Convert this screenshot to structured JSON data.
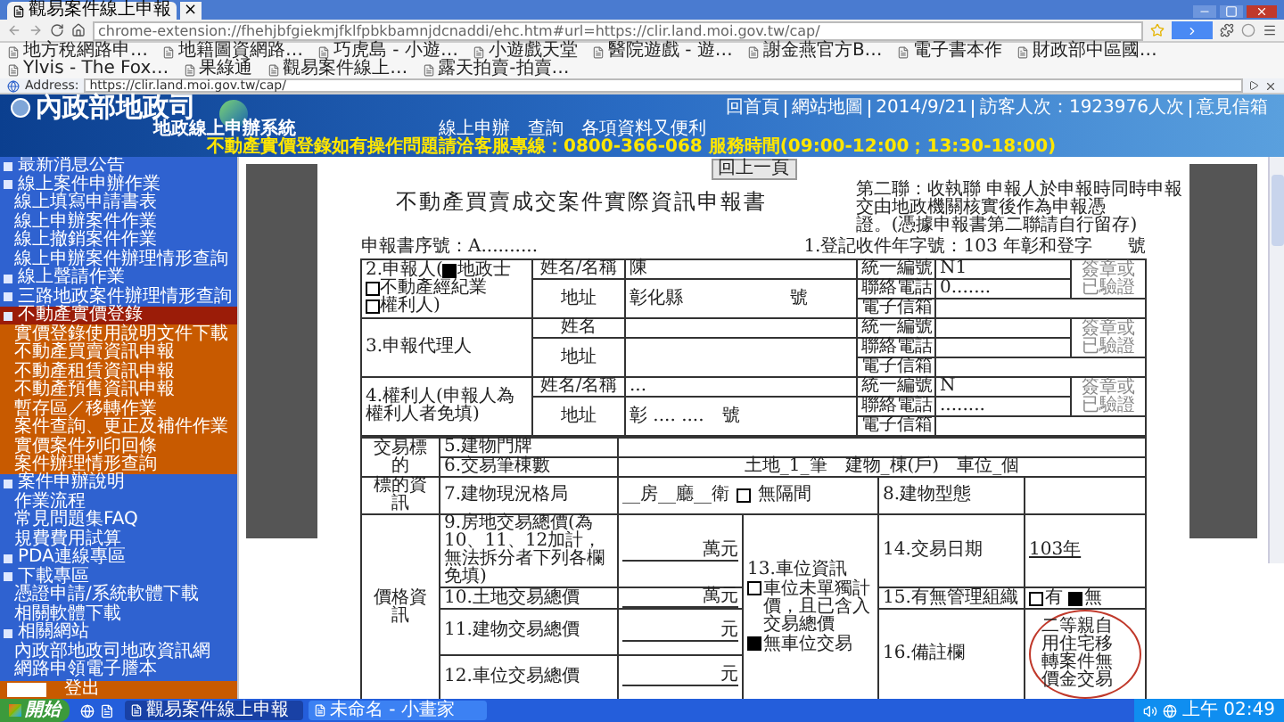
{
  "browser": {
    "tab_title": "觀易案件線上申報",
    "tab_close": "×",
    "url": "chrome-extension://fhehjbfgiekmjfklfpbkbamnjdcnaddi/ehc.htm#url=https://clir.land.moi.gov.tw/cap/",
    "bookmarks": [
      "地方稅網路申…",
      "地籍圖資網路…",
      "巧虎島 - 小遊…",
      "小遊戲天堂",
      "醫院遊戲 - 遊…",
      "謝金燕官方B…",
      "電子書本作",
      "財政部中區國…",
      "Ylvis - The Fox…",
      "果綠通",
      "觀易案件線上…",
      "露天拍賣-拍賣…"
    ],
    "ie_address_label": "Address:",
    "ie_address": "https://clir.land.moi.gov.tw/cap/"
  },
  "banner": {
    "title": "內政部地政司",
    "subtitle": "地政線上申辦系統",
    "links": [
      "回首頁",
      "網站地圖",
      "2014/9/21",
      "訪客人次：1923976人次",
      "意見信箱"
    ],
    "slogans": [
      "線上申辦",
      "查詢",
      "各項資料又便利"
    ],
    "marquee": "不動產實價登錄如有操作問題請洽客服專線：0800-366-068 服務時間(09:00-12:00；13:30-18:00)"
  },
  "sidebar": {
    "items": [
      {
        "label": "最新消息公告",
        "kind": "header",
        "selected": false
      },
      {
        "label": "線上案件申辦作業",
        "kind": "header",
        "selected": false
      },
      {
        "label": "線上填寫申請書表",
        "kind": "link",
        "selected": false
      },
      {
        "label": "線上申辦案件作業",
        "kind": "link",
        "selected": false
      },
      {
        "label": "線上撤銷案件作業",
        "kind": "link",
        "selected": false
      },
      {
        "label": "線上申辦案件辦理情形查詢",
        "kind": "link",
        "selected": false
      },
      {
        "label": "線上聲請作業",
        "kind": "header",
        "selected": false
      },
      {
        "label": "三路地政案件辦理情形查詢",
        "kind": "header",
        "selected": false
      },
      {
        "label": "不動產實價登錄",
        "kind": "header",
        "selected": true
      },
      {
        "label": "實價登錄使用說明文件下載",
        "kind": "sub",
        "selected": false
      },
      {
        "label": "不動產買賣資訊申報",
        "kind": "sub",
        "selected": false
      },
      {
        "label": "不動產租賃資訊申報",
        "kind": "sub",
        "selected": false
      },
      {
        "label": "不動產預售資訊申報",
        "kind": "sub",
        "selected": false
      },
      {
        "label": "暫存區／移轉作業",
        "kind": "sub",
        "selected": false
      },
      {
        "label": "案件查詢、更正及補件作業",
        "kind": "sub",
        "selected": false
      },
      {
        "label": "實價案件列印回條",
        "kind": "sub",
        "selected": false
      },
      {
        "label": "案件辦理情形查詢",
        "kind": "sub",
        "selected": false
      },
      {
        "label": "案件申辦說明",
        "kind": "header",
        "selected": false
      },
      {
        "label": "作業流程",
        "kind": "link",
        "selected": false
      },
      {
        "label": "常見問題集FAQ",
        "kind": "link",
        "selected": false
      },
      {
        "label": "規費費用試算",
        "kind": "link",
        "selected": false
      },
      {
        "label": "PDA連線專區",
        "kind": "header",
        "selected": false
      },
      {
        "label": "下載專區",
        "kind": "header",
        "selected": false
      },
      {
        "label": "憑證申請/系統軟體下載",
        "kind": "link",
        "selected": false
      },
      {
        "label": "相關軟體下載",
        "kind": "link",
        "selected": false
      },
      {
        "label": "相關網站",
        "kind": "header",
        "selected": false
      },
      {
        "label": "內政部地政司地政資訊網",
        "kind": "link",
        "selected": false
      },
      {
        "label": "網路申領電子謄本",
        "kind": "link",
        "selected": false
      }
    ],
    "logout": "登出"
  },
  "form": {
    "back_button": "回上一頁",
    "title": "不動產買賣成交案件實際資訊申報書",
    "note": [
      "第二聯：收執聯 申報人於申報時同時申報",
      "交由地政機關核實後作為申報憑",
      "證。(憑據申報書第二聯請自行留存)"
    ],
    "serial": "申報書序號：A..........",
    "receipt": "1.登記收件年字號：103 年彰和登字　　號",
    "parties": [
      {
        "label": "2.申報人(",
        "options": [
          {
            "label": "地政士",
            "checked": true
          },
          {
            "label": "不動產經紀業",
            "checked": false
          },
          {
            "label": "權利人",
            "checked": false
          }
        ],
        "label_end": ")",
        "fields": [
          {
            "label": "姓名/名稱",
            "value": "陳"
          },
          {
            "label": "地址",
            "value": "彰化縣　　　　　　號"
          }
        ],
        "contacts": [
          {
            "label": "統一編號",
            "value": "N1"
          },
          {
            "label": "聯絡電話",
            "value": "0.......  "
          },
          {
            "label": "電子信箱"
          }
        ],
        "stamp": "簽章或已驗證"
      },
      {
        "label": "3.申報代理人",
        "fields": [
          {
            "label": "姓名"
          },
          {
            "label": "地址"
          }
        ],
        "contacts": [
          {
            "label": "統一編號"
          },
          {
            "label": "聯絡電話"
          },
          {
            "label": "電子信箱"
          }
        ],
        "stamp": "簽章或已驗證"
      },
      {
        "label": "4.權利人(申報人為權利人者免填)",
        "fields": [
          {
            "label": "姓名/名稱",
            "value": "..."
          },
          {
            "label": "地址",
            "value": "彰 .... ....　號"
          }
        ],
        "contacts": [
          {
            "label": "統一編號",
            "value": "N"
          },
          {
            "label": "聯絡電話",
            "value": "........"
          },
          {
            "label": "電子信箱"
          }
        ],
        "stamp": "簽章或已驗證"
      }
    ],
    "target": {
      "label": "交易標的",
      "items": [
        {
          "label": "5.建物門牌"
        },
        {
          "label": "6.交易筆棟數",
          "value": "土地_1_筆　建物_棟(戶)　車位_個"
        }
      ]
    },
    "info": {
      "label": "標的資訊",
      "layout": {
        "label": "7.建物現況格局",
        "value": "__房__廳__衛",
        "option": {
          "label": "無隔間",
          "checked": false
        }
      },
      "type": {
        "label": "8.建物型態"
      }
    },
    "price": {
      "label": "價格資訊",
      "items": [
        {
          "label": "9.房地交易總價(為10、11、12加計，無法拆分者下列各欄免填)",
          "unit": "萬元"
        },
        {
          "label": "10.土地交易總價",
          "unit": "萬元"
        },
        {
          "label": "11.建物交易總價",
          "unit": "元"
        },
        {
          "label": "12.車位交易總價",
          "unit": "元"
        }
      ],
      "parking": {
        "label": "13.車位資訊",
        "options": [
          {
            "label": "車位未單獨計價，且已含入交易總價",
            "checked": false
          },
          {
            "label": "無車位交易",
            "checked": true
          }
        ]
      },
      "date": {
        "label": "14.交易日期",
        "value": "103年"
      },
      "management": {
        "label": "15.有無管理組織",
        "options": [
          {
            "label": "有",
            "checked": false
          },
          {
            "label": "無",
            "checked": true
          }
        ]
      },
      "remark": {
        "label": "16.備註欄",
        "value": "二等親自用住宅移轉案件無價金交易"
      }
    }
  },
  "taskbar": {
    "start": "開始",
    "tasks": [
      {
        "label": "觀易案件線上申報",
        "selected": true
      },
      {
        "label": "未命名 - 小畫家",
        "selected": false
      }
    ],
    "clock": "上午 02:49"
  }
}
